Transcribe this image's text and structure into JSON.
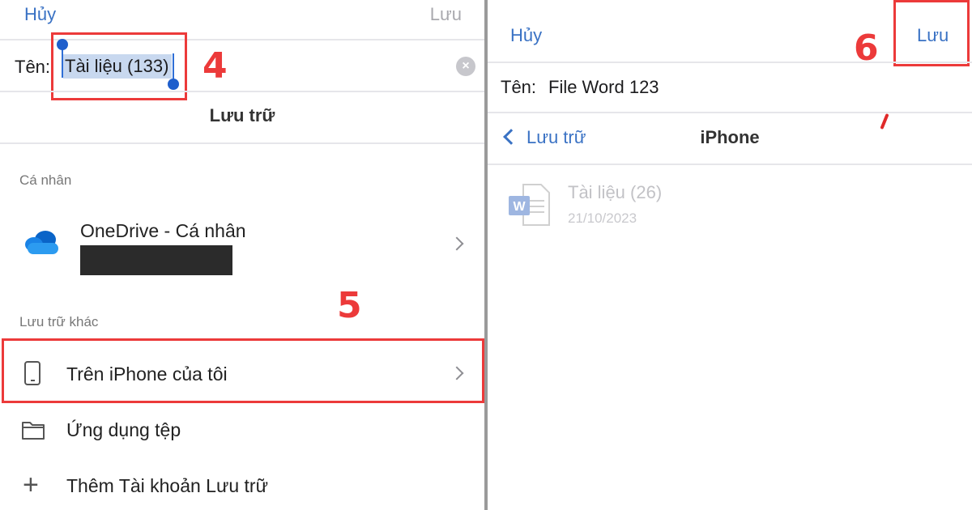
{
  "left": {
    "nav": {
      "cancel": "Hủy",
      "save": "Lưu"
    },
    "name_label": "Tên:",
    "name_value": "Tài liệu (133)",
    "title": "Lưu trữ",
    "section_personal": "Cá nhân",
    "onedrive_label": "OneDrive - Cá nhân",
    "section_other": "Lưu trữ khác",
    "rows": [
      {
        "label": "Trên iPhone của tôi",
        "icon": "phone-icon"
      },
      {
        "label": "Ứng dụng tệp",
        "icon": "folder-icon"
      },
      {
        "label": "Thêm Tài khoản Lưu trữ",
        "icon": "plus-icon"
      }
    ]
  },
  "right": {
    "nav": {
      "cancel": "Hủy",
      "save": "Lưu"
    },
    "name_label": "Tên:",
    "name_value": "File Word 123",
    "back_label": "Lưu trữ",
    "title": "iPhone",
    "files": [
      {
        "name": "Tài liệu (26)",
        "date": "21/10/2023",
        "icon": "word-file-icon"
      }
    ]
  },
  "annotations": {
    "step4": "4",
    "step5": "5",
    "step6": "6"
  },
  "colors": {
    "accent": "#3a72c4",
    "highlight_red": "#ec3a3a",
    "selection": "#c8d8ef"
  }
}
